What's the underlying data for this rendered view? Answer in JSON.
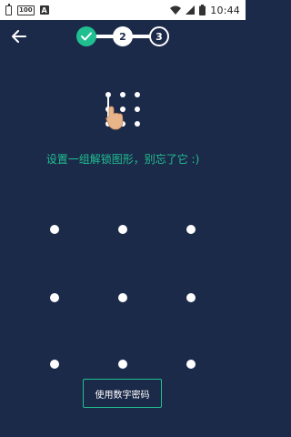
{
  "status_bar": {
    "badge_100": "100",
    "badge_a": "A",
    "time": "10:44",
    "icons": [
      "battery-small-icon",
      "badge-100-icon",
      "a-notification-icon",
      "wifi-icon",
      "signal-icon",
      "battery-icon"
    ]
  },
  "header": {
    "back_icon": "arrow-left-icon",
    "steps": [
      {
        "label": "✓",
        "state": "done"
      },
      {
        "label": "2",
        "state": "current"
      },
      {
        "label": "3",
        "state": "pending"
      }
    ]
  },
  "hint_text": "设置一组解锁图形，别忘了它 :)",
  "pattern": {
    "rows": 3,
    "cols": 3,
    "dot_color": "#ffffff"
  },
  "pin_button": {
    "label": "使用数字密码"
  },
  "colors": {
    "background": "#1c2a4a",
    "accent": "#1fbf8f",
    "status_bar": "#ffffff"
  }
}
